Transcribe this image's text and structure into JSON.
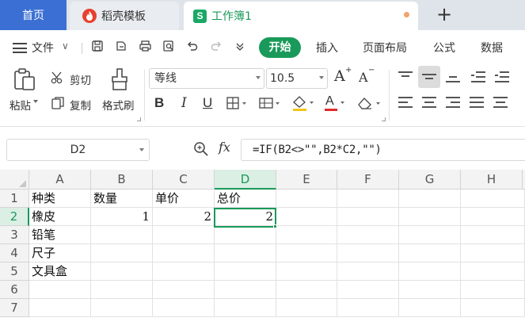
{
  "tabs": {
    "home": "首页",
    "template": "稻壳模板",
    "workbook": "工作簿1",
    "workbook_icon_letter": "S",
    "new_tab": "+"
  },
  "menu": {
    "file": "文件",
    "items": [
      "开始",
      "插入",
      "页面布局",
      "公式",
      "数据"
    ],
    "active": "开始",
    "accent": "#1a9a5a"
  },
  "ribbon": {
    "paste": "粘贴",
    "cut": "剪切",
    "copy": "复制",
    "format_painter": "格式刷",
    "font_name": "等线",
    "font_size": "10.5",
    "bold": "B",
    "italic": "I",
    "underline": "U",
    "font_color_letter": "A",
    "grow_font": "A",
    "shrink_font": "A"
  },
  "formula_bar": {
    "name_box": "D2",
    "fx": "fx",
    "formula": "=IF(B2<>\"\",B2*C2,\"\")"
  },
  "sheet": {
    "columns": [
      "A",
      "B",
      "C",
      "D",
      "E",
      "F",
      "G",
      "H"
    ],
    "active_column": "D",
    "rows": [
      "1",
      "2",
      "3",
      "4",
      "5",
      "6",
      "7"
    ],
    "active_row": "2",
    "cells": {
      "A1": "种类",
      "B1": "数量",
      "C1": "单价",
      "D1": "总价",
      "A2": "橡皮",
      "B2": "1",
      "C2": "2",
      "D2": "2",
      "A3": "铅笔",
      "A4": "尺子",
      "A5": "文具盒"
    },
    "selected_cell": "D2"
  }
}
